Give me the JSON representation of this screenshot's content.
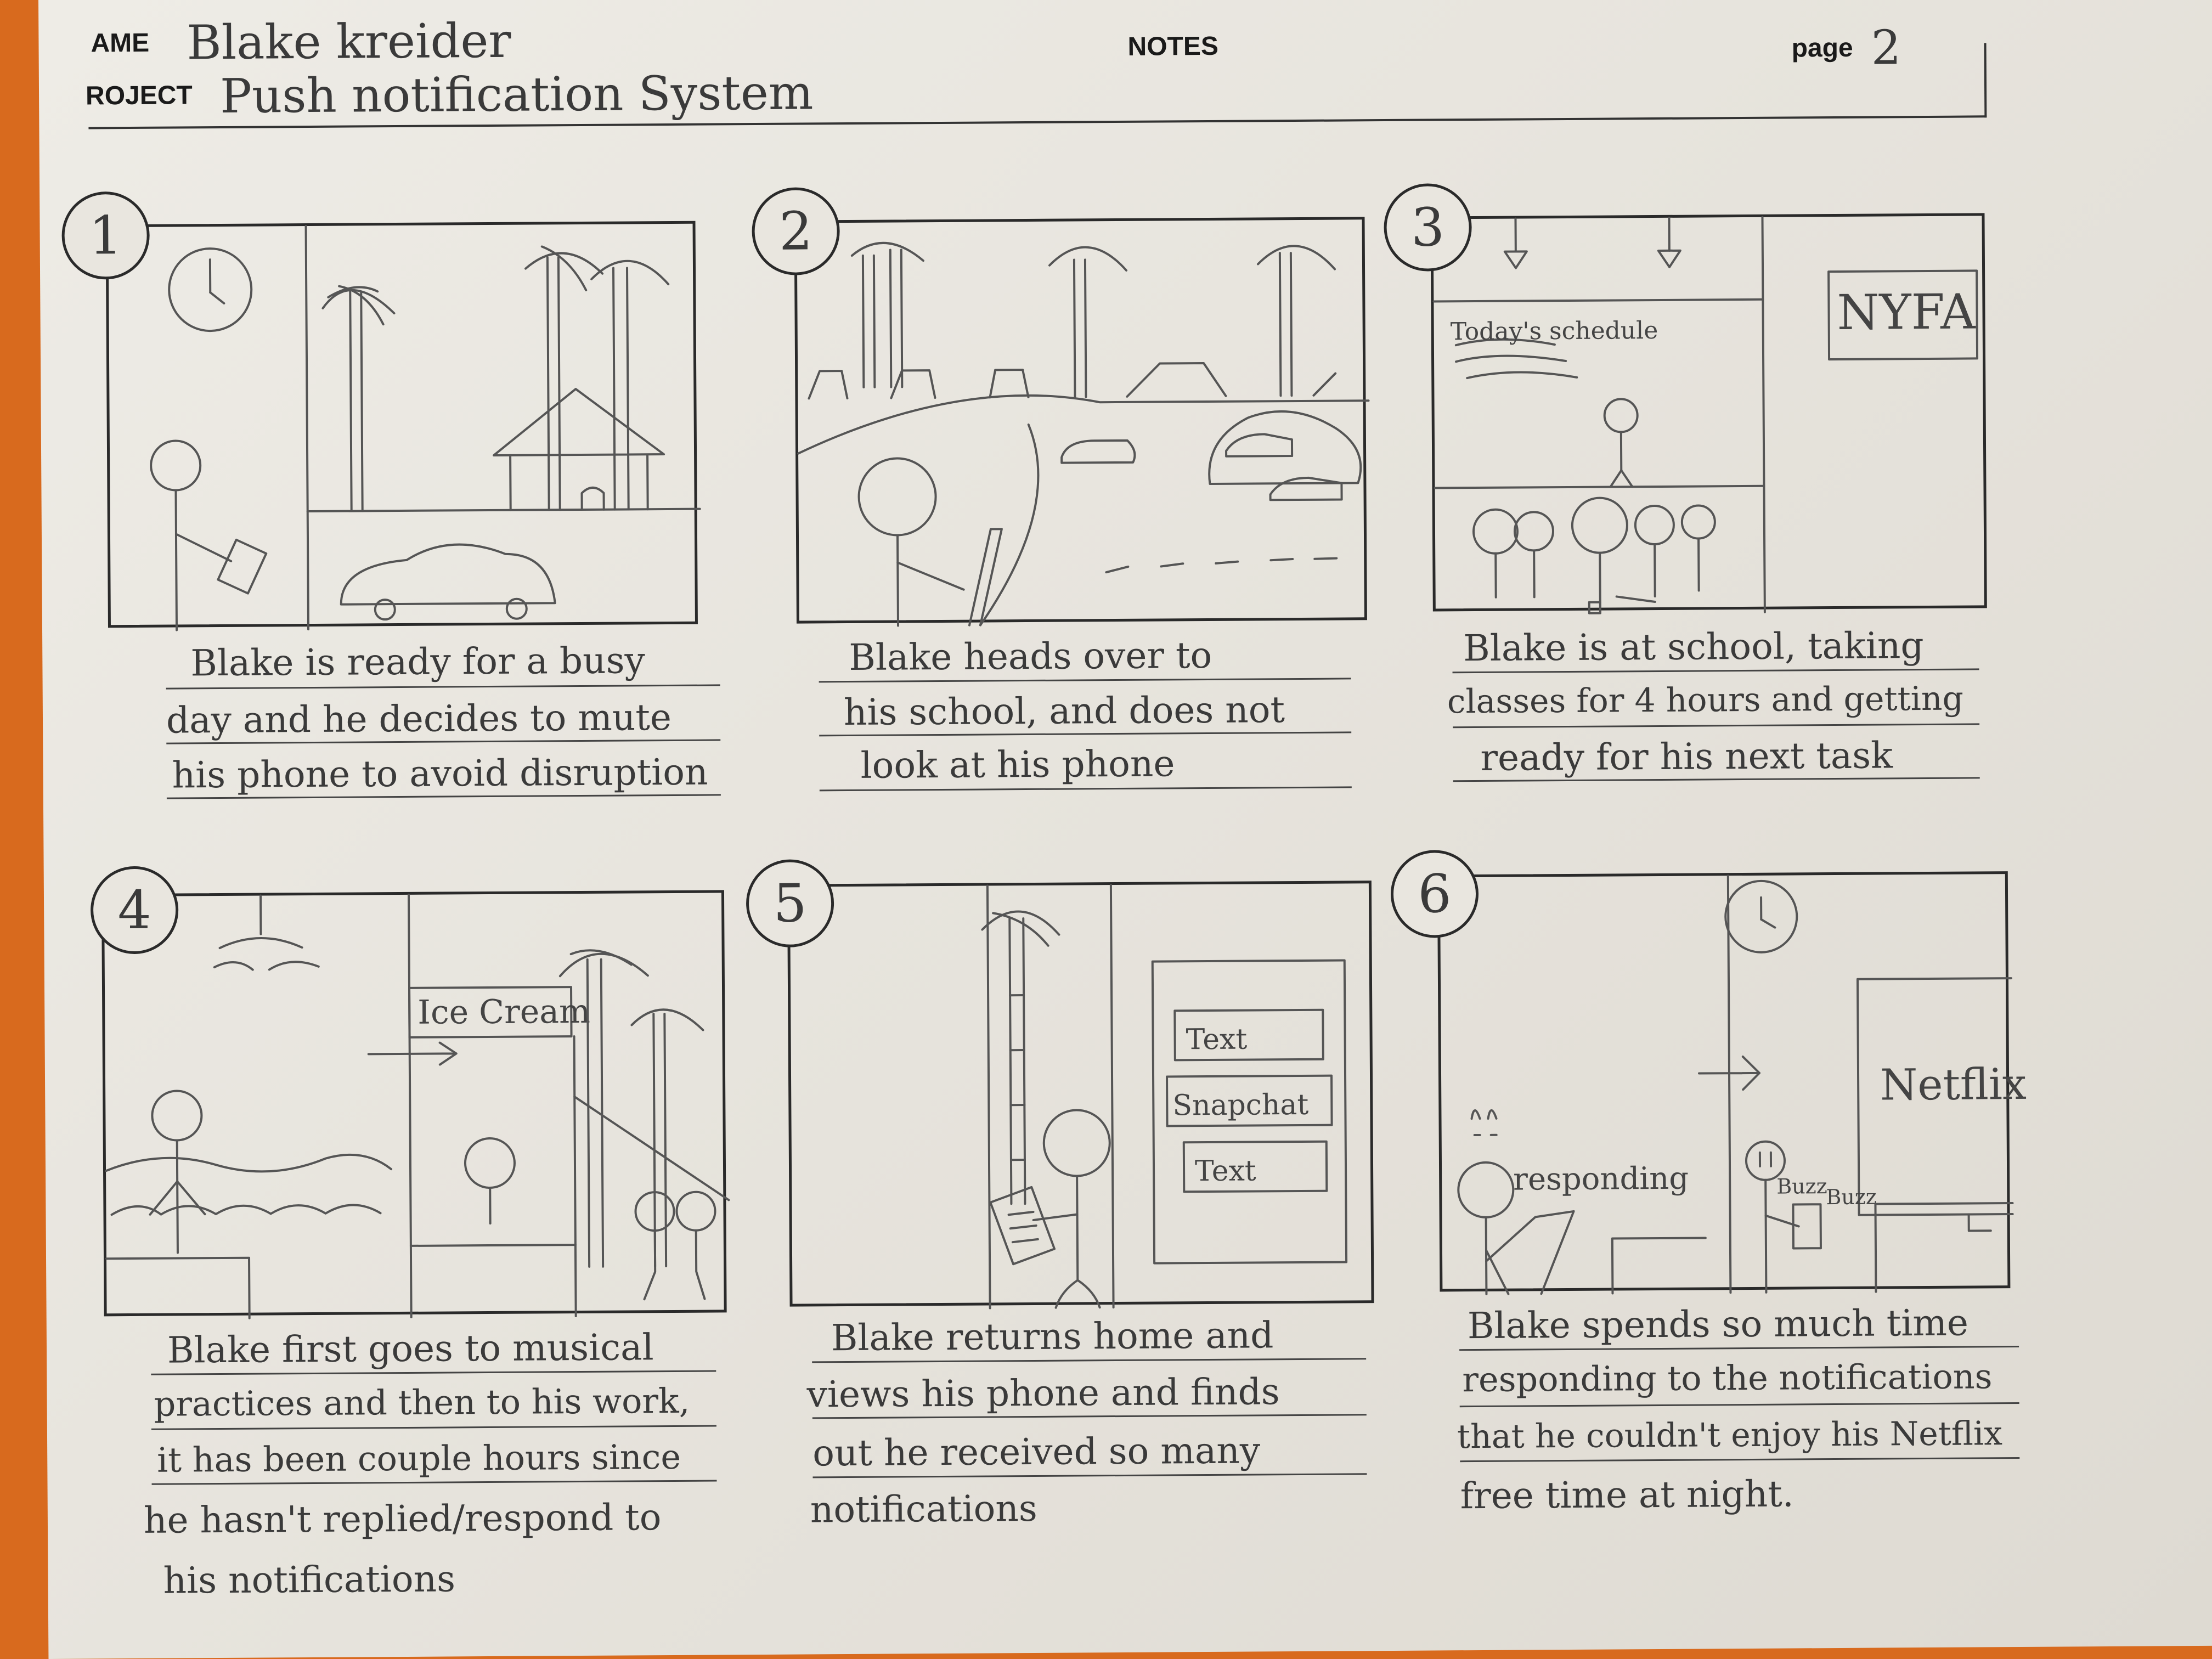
{
  "header": {
    "name_label": "AME",
    "name_value": "Blake kreider",
    "project_label": "ROJECT",
    "project_value": "Push notification System",
    "notes_label": "NOTES",
    "page_label": "page",
    "page_value": "2"
  },
  "panels": [
    {
      "number": "1",
      "caption_lines": [
        "Blake is ready for a busy",
        "day and he decides to mute",
        "his phone to avoid disruption"
      ]
    },
    {
      "number": "2",
      "caption_lines": [
        "Blake heads over to",
        "his school, and does not",
        "look at his phone"
      ],
      "sketch_text": []
    },
    {
      "number": "3",
      "caption_lines": [
        "Blake is at school, taking",
        "classes for 4 hours and getting",
        "ready for his next task"
      ],
      "sketch_text": [
        "Today's schedule",
        "NYFA"
      ]
    },
    {
      "number": "4",
      "caption_lines": [
        "Blake first goes to musical",
        "practices and then to his work,",
        "it has been couple hours since",
        "he hasn't replied/respond to",
        "his notifications"
      ],
      "sketch_text": [
        "Ice Cream"
      ]
    },
    {
      "number": "5",
      "caption_lines": [
        "Blake returns home and",
        "views his phone and finds",
        "out he received so many",
        "notifications"
      ],
      "sketch_text": [
        "Text",
        "Snapchat",
        "Text"
      ]
    },
    {
      "number": "6",
      "caption_lines": [
        "Blake spends so much time",
        "responding to the notifications",
        "that he couldn't enjoy his Netflix",
        "free time at night."
      ],
      "sketch_text": [
        "responding",
        "Netflix",
        "Buzz",
        "Buzz"
      ]
    }
  ]
}
